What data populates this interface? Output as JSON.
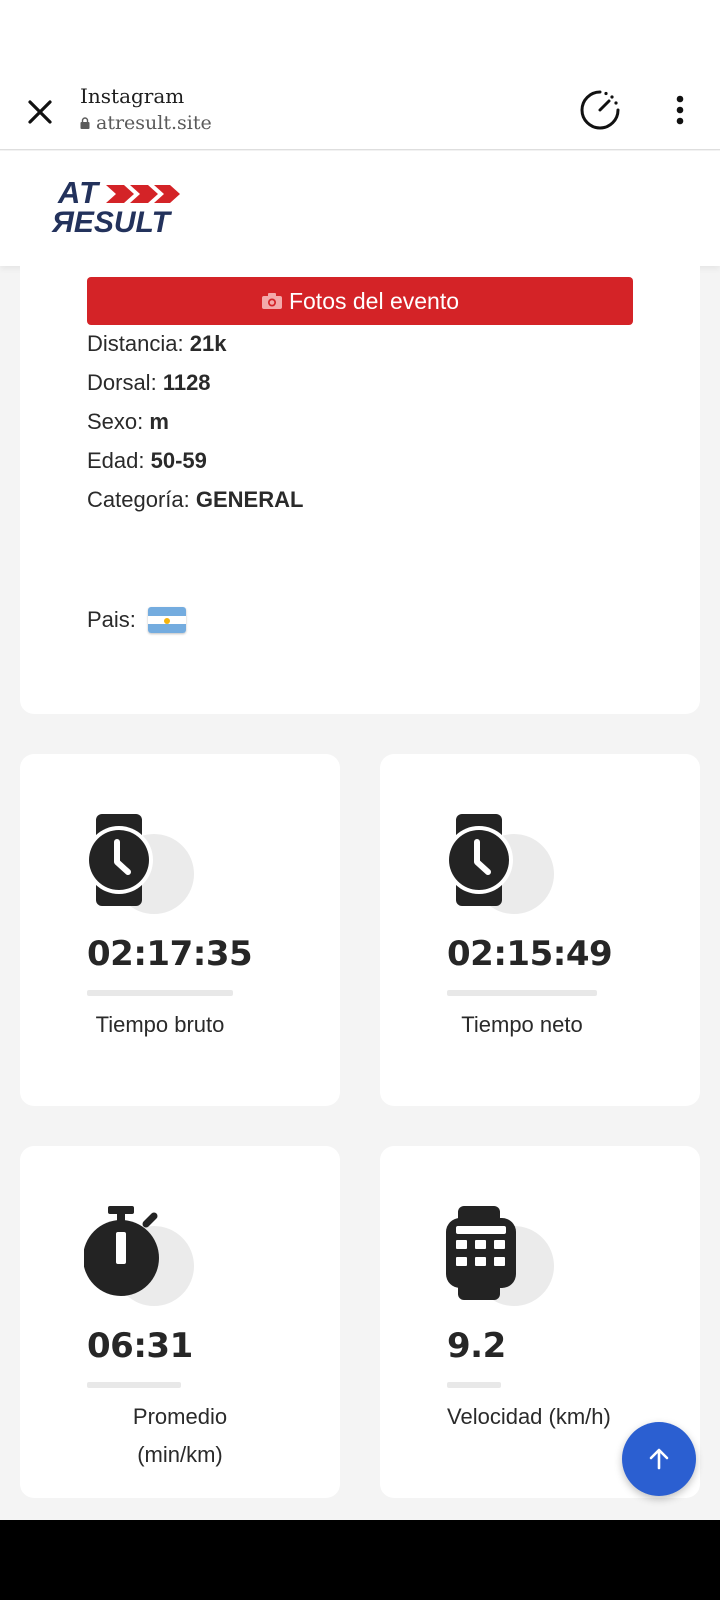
{
  "browser": {
    "title": "Instagram",
    "url": "atresult.site"
  },
  "site": {
    "logo_top": "AT",
    "logo_bottom": "ЯESULT"
  },
  "info": {
    "photos_button": "Fotos del evento",
    "distance_label": "Distancia:",
    "distance_value": "21k",
    "bib_label": "Dorsal:",
    "bib_value": "1128",
    "sex_label": "Sexo:",
    "sex_value": "m",
    "age_label": "Edad:",
    "age_value": "50-59",
    "category_label": "Categoría:",
    "category_value": "GENERAL",
    "country_label": "Pais:",
    "country_flag_icon": "argentina-flag-icon"
  },
  "stats": [
    {
      "value": "02:17:35",
      "label": "Tiempo bruto",
      "icon": "watch-icon"
    },
    {
      "value": "02:15:49",
      "label": "Tiempo neto",
      "icon": "watch-icon"
    },
    {
      "value": "06:31",
      "label_line1": "Promedio",
      "label_line2": "(min/km)",
      "icon": "stopwatch-icon"
    },
    {
      "value": "9.2",
      "label": "Velocidad (km/h)",
      "icon": "calculator-watch-icon"
    }
  ],
  "colors": {
    "brand_navy": "#23325c",
    "brand_red": "#d42327",
    "fab_blue": "#2b5fd1"
  }
}
